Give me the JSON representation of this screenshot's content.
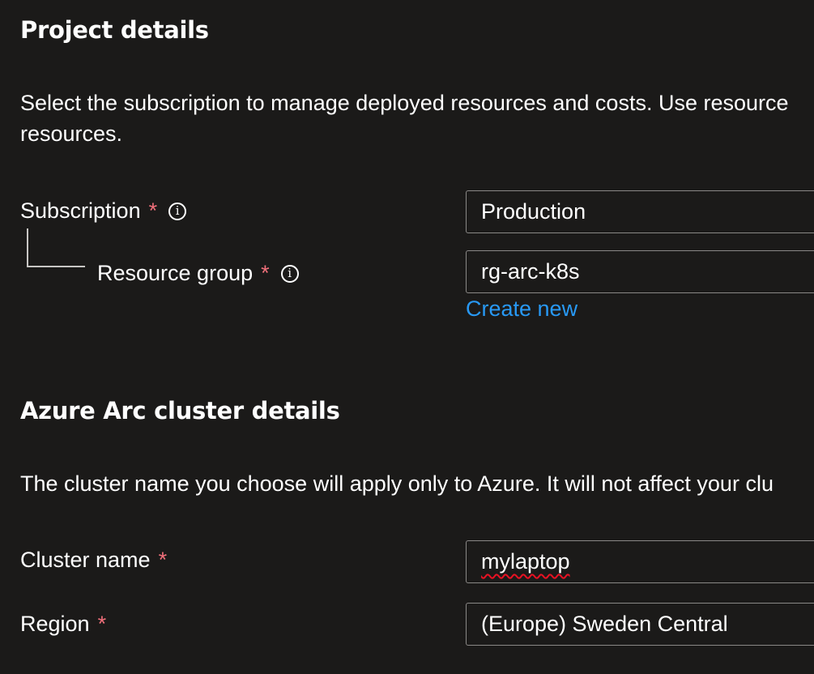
{
  "project": {
    "heading": "Project details",
    "description_line1": "Select the subscription to manage deployed resources and costs. Use resource",
    "description_line2": "resources.",
    "subscription_label": "Subscription",
    "subscription_value": "Production",
    "resource_group_label": "Resource group",
    "resource_group_value": "rg-arc-k8s",
    "create_new_link": "Create new"
  },
  "cluster": {
    "heading": "Azure Arc cluster details",
    "description": "The cluster name you choose will apply only to Azure. It will not affect your clu",
    "cluster_name_label": "Cluster name",
    "cluster_name_value": "mylaptop",
    "region_label": "Region",
    "region_value": "(Europe) Sweden Central"
  },
  "common": {
    "required_marker": "*",
    "info_glyph": "i"
  },
  "colors": {
    "background": "#1b1a19",
    "required": "#f1707b",
    "link": "#2899f5",
    "field_border": "#8a8886"
  },
  "icons": {
    "info": "info-icon"
  }
}
